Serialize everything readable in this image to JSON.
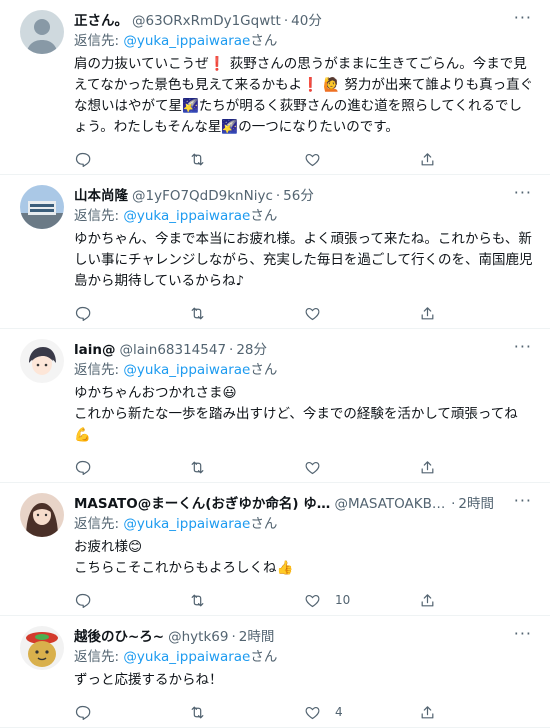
{
  "reply_prefix": "返信先: ",
  "tweets": [
    {
      "name": "正さん。",
      "handle": "@63ORxRmDy1Gqwtt",
      "time": "40分",
      "reply_to": "@yuka_ippaiwarae",
      "reply_suffix": "さん",
      "text": "肩の力抜いていこうぜ❗ 荻野さんの思うがままに生きてごらん。今まで見えてなかった景色も見えて来るかもよ❗ 🙋 努力が出来て誰よりも真っ直ぐな想いはやがて星🌠たちが明るく荻野さんの進む道を照らしてくれるでしょう。わたしもそんな星🌠の一つになりたいのです。",
      "likes": "",
      "avatar": "default"
    },
    {
      "name": "山本尚隆",
      "handle": "@1yFO7QdD9knNiyc",
      "time": "56分",
      "reply_to": "@yuka_ippaiwarae",
      "reply_suffix": "さん",
      "text": "ゆかちゃん、今まで本当にお疲れ様。よく頑張って来たね。これからも、新しい事にチャレンジしながら、充実した毎日を過ごして行くのを、南国鹿児島から期待しているからね♪",
      "likes": "",
      "avatar": "building"
    },
    {
      "name": "lain@",
      "handle": "@lain68314547",
      "time": "28分",
      "reply_to": "@yuka_ippaiwarae",
      "reply_suffix": "さん",
      "text": "ゆかちゃんおつかれさま😃\nこれから新たな一歩を踏み出すけど、今までの経験を活かして頑張ってね💪",
      "likes": "",
      "avatar": "anime"
    },
    {
      "name": "MASATO@まーくん(おぎゆか命名) ゆか…",
      "handle": "@MASATOAKB4…",
      "time": "2時間",
      "reply_to": "@yuka_ippaiwarae",
      "reply_suffix": "さん",
      "text": "お疲れ様😊\nこちらこそこれからもよろしくね👍",
      "likes": "10",
      "avatar": "girl"
    },
    {
      "name": "越後のひ~ろ~",
      "handle": "@hytk69",
      "time": "2時間",
      "reply_to": "@yuka_ippaiwarae",
      "reply_suffix": "さん",
      "text": "ずっと応援するからね！",
      "likes": "4",
      "avatar": "character"
    }
  ]
}
